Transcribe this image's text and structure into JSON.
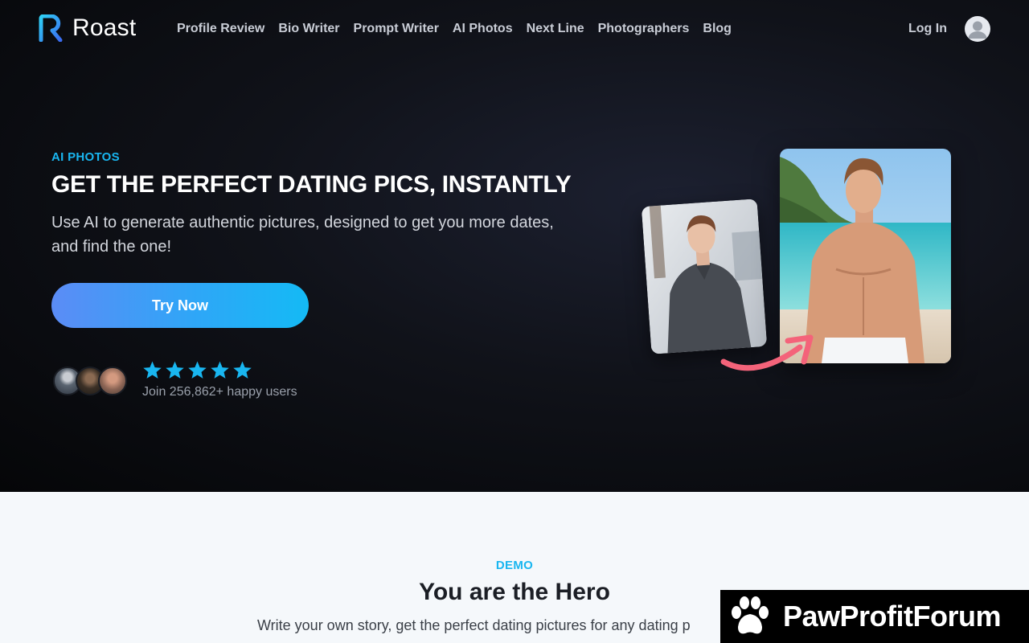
{
  "brand": {
    "name": "Roast"
  },
  "nav": {
    "links": [
      "Profile Review",
      "Bio Writer",
      "Prompt Writer",
      "AI Photos",
      "Next Line",
      "Photographers",
      "Blog"
    ],
    "login": "Log In"
  },
  "hero": {
    "eyebrow": "AI PHOTOS",
    "headline": "GET THE PERFECT DATING PICS, INSTANTLY",
    "subtext": "Use AI to generate authentic pictures, designed to get you more dates, and find the one!",
    "cta": "Try Now",
    "rating_stars": 5,
    "social_proof": "Join 256,862+ happy users"
  },
  "demo": {
    "label": "DEMO",
    "title": "You are the Hero",
    "subtitle": "Write your own story, get the perfect dating pictures for any dating p"
  },
  "watermark": {
    "text": "PawProfitForum"
  },
  "colors": {
    "accent": "#19b6f0",
    "cta_start": "#5b8cf6",
    "cta_end": "#14baf5",
    "arrow": "#f4637a"
  }
}
